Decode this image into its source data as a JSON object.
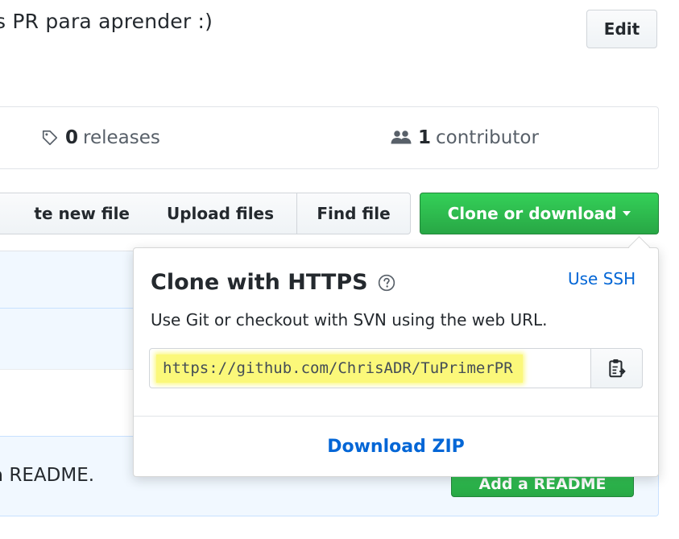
{
  "repo": {
    "description": "s PR para aprender :)",
    "edit_label": "Edit"
  },
  "summary": {
    "releases_count": "0",
    "releases_label": "releases",
    "releases_icon": "tag-icon",
    "contributors_count": "1",
    "contributors_label": "contributor",
    "contributors_icon": "people-icon"
  },
  "toolbar": {
    "create_label": "te new file",
    "upload_label": "Upload files",
    "find_label": "Find file",
    "clone_label": "Clone or download"
  },
  "clone_popover": {
    "title": "Clone with HTTPS",
    "help_icon": "question-icon",
    "use_ssh_label": "Use SSH",
    "description": "Use Git or checkout with SVN using the web URL.",
    "url": "https://github.com/ChrisADR/TuPrimerPR",
    "copy_icon": "clipboard-icon",
    "download_zip_label": "Download ZIP"
  },
  "readme_banner": {
    "text": "a README.",
    "button_label": "Add a README"
  },
  "colors": {
    "primary_green": "#28a745",
    "link_blue": "#0366d6",
    "highlight_yellow": "#fbf87a"
  }
}
